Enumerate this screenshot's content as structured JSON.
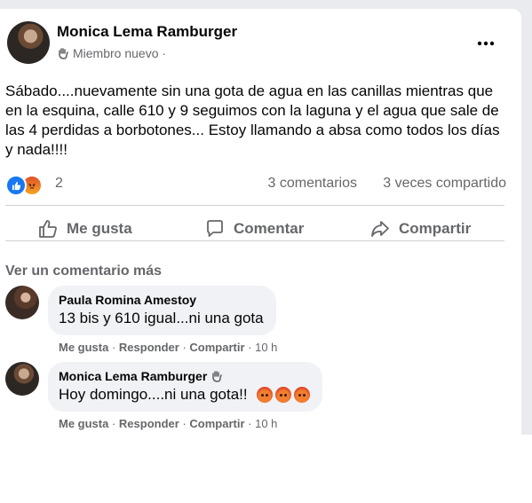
{
  "post": {
    "author": "Monica Lema Ramburger",
    "badge": "Miembro nuevo ·",
    "text": "Sábado....nuevamente sin una gota de agua en las canillas mientras que en la esquina, calle 610 y 9 seguimos con la laguna y el agua que sale de las 4 perdidas a borbotones...  Estoy llamando a absa como todos los días y nada!!!!",
    "reaction_count": "2",
    "comments_count": "3 comentarios",
    "shares_count": "3 veces compartido",
    "reactions": [
      "like-icon",
      "angry-icon"
    ]
  },
  "actions": {
    "like": "Me gusta",
    "comment": "Comentar",
    "share": "Compartir"
  },
  "see_more": "Ver un comentario más",
  "comments": [
    {
      "author": "Paula Romina Amestoy",
      "text": "13 bis y 610 igual...ni una gota",
      "like": "Me gusta",
      "reply": "Responder",
      "share": "Compartir",
      "time": "10 h"
    },
    {
      "author": "Monica Lema Ramburger",
      "text": "Hoy domingo....ni una gota!!",
      "emojis": [
        "angry-emoji",
        "angry-emoji",
        "angry-emoji"
      ],
      "like": "Me gusta",
      "reply": "Responder",
      "share": "Compartir",
      "time": "10 h"
    }
  ],
  "colors": {
    "primary_text": "#050505",
    "secondary_text": "#65676b",
    "bubble": "#f0f2f5",
    "like_blue": "#1877f2",
    "divider": "#ced0d4"
  }
}
